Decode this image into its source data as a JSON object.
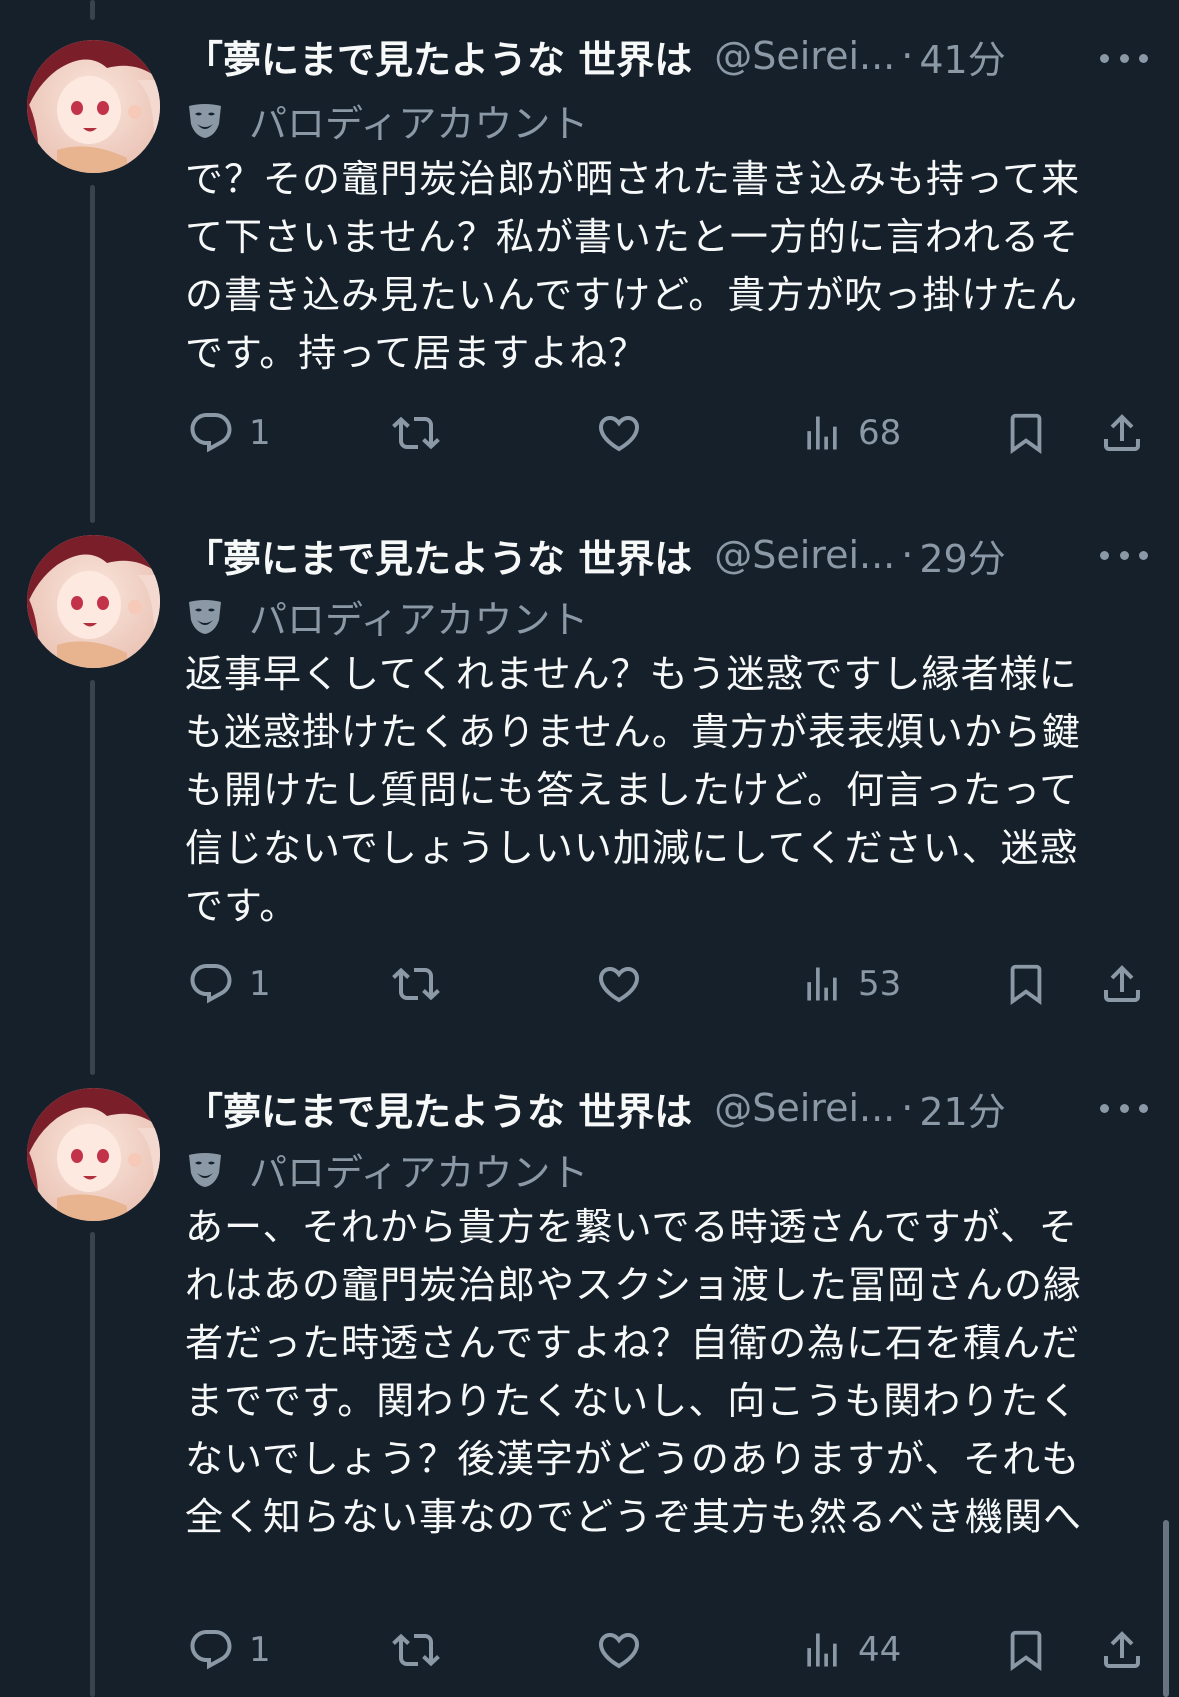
{
  "colors": {
    "background": "#15202b",
    "text_primary": "#f7f9f9",
    "text_secondary": "#8b98a5",
    "thread_line": "#38444d"
  },
  "tweets": [
    {
      "display_name": "「夢にまで見たような 世界は",
      "handle": "@Seirei...",
      "separator": "·",
      "time": "41分",
      "parody_label": "パロディアカウント",
      "parody_icon": "theater-mask-icon",
      "text": "で？その竈門炭治郎が晒された書き込みも持って来て下さいません？私が書いたと一方的に言われるその書き込み見たいんですけど。貴方が吹っ掛けたんです。持って居ますよね？",
      "reply_count": "1",
      "retweet_count": "",
      "like_count": "",
      "views": "68"
    },
    {
      "display_name": "「夢にまで見たような 世界は",
      "handle": "@Seirei...",
      "separator": "·",
      "time": "29分",
      "parody_label": "パロディアカウント",
      "parody_icon": "theater-mask-icon",
      "text": "返事早くしてくれません？もう迷惑ですし縁者様にも迷惑掛けたくありません。貴方が表表煩いから鍵も開けたし質問にも答えましたけど。何言ったって信じないでしょうしいい加減にしてください、迷惑です。",
      "reply_count": "1",
      "retweet_count": "",
      "like_count": "",
      "views": "53"
    },
    {
      "display_name": "「夢にまで見たような 世界は",
      "handle": "@Seirei...",
      "separator": "·",
      "time": "21分",
      "parody_label": "パロディアカウント",
      "parody_icon": "theater-mask-icon",
      "text": "あー、それから貴方を繋いでる時透さんですが、それはあの竈門炭治郎やスクショ渡した冨岡さんの縁者だった時透さんですよね？自衛の為に石を積んだまでです。関わりたくないし、向こうも関わりたくないでしょう？後漢字がどうのありますが、それも全く知らない事なのでどうぞ其方も然るべき機関へ",
      "reply_count": "1",
      "retweet_count": "",
      "like_count": "",
      "views": "44"
    }
  ]
}
